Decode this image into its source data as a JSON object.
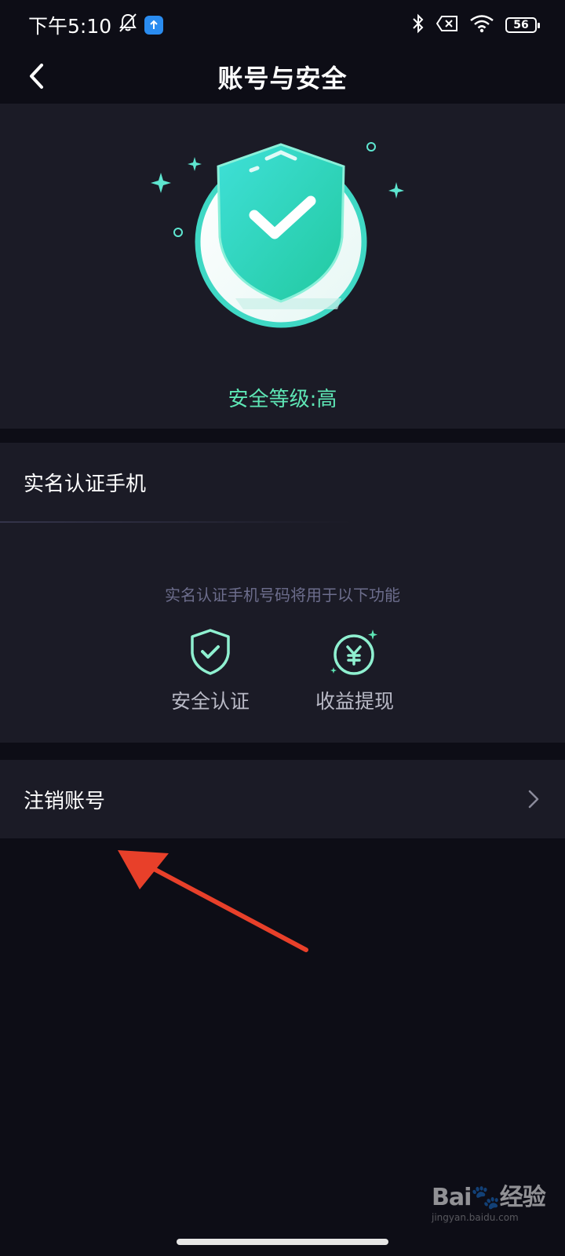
{
  "status_bar": {
    "time": "下午5:10",
    "battery": "56"
  },
  "nav": {
    "title": "账号与安全"
  },
  "hero": {
    "security_level": "安全等级:高"
  },
  "verification": {
    "title": "实名认证手机",
    "description": "实名认证手机号码将用于以下功能",
    "features": [
      {
        "label": "安全认证",
        "icon": "shield-check-icon"
      },
      {
        "label": "收益提现",
        "icon": "yuan-coin-icon"
      }
    ]
  },
  "account": {
    "deregister_label": "注销账号"
  },
  "watermark": {
    "brand": "Bai",
    "brand2": "经验",
    "sub": "jingyan.baidu.com"
  },
  "colors": {
    "accent": "#5ee6b5",
    "background": "#0d0d16",
    "card": "#1b1b26",
    "arrow": "#e8402a"
  }
}
